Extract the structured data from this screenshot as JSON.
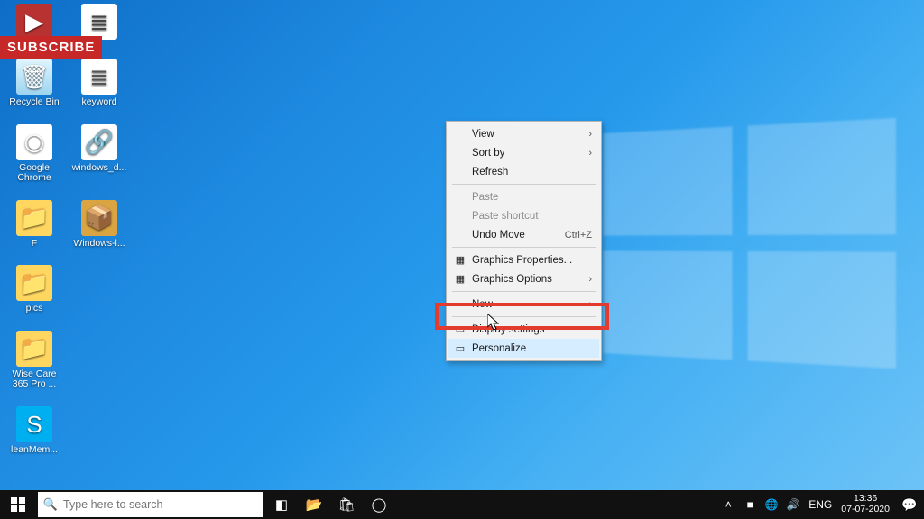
{
  "subscribe_label": "SUBSCRIBE",
  "desktop": {
    "icons": [
      [
        {
          "label": "",
          "glyph": "▶",
          "cls": "g-video",
          "name": "youtube-play-icon"
        },
        {
          "label": "",
          "glyph": "≣",
          "cls": "g-doc",
          "name": "document-icon"
        }
      ],
      [
        {
          "label": "Recycle Bin",
          "glyph": "🗑",
          "cls": "g-bin",
          "name": "recycle-bin-icon"
        },
        {
          "label": "keyword",
          "glyph": "≣",
          "cls": "g-txt",
          "name": "text-file-icon"
        }
      ],
      [
        {
          "label": "Google Chrome",
          "glyph": "◉",
          "cls": "g-chrome",
          "name": "chrome-icon"
        },
        {
          "label": "windows_d...",
          "glyph": "🔗",
          "cls": "g-link",
          "name": "shortcut-icon"
        }
      ],
      [
        {
          "label": "F",
          "glyph": "📁",
          "cls": "g-folder",
          "name": "folder-icon"
        },
        {
          "label": "Windows-l...",
          "glyph": "📦",
          "cls": "g-chest",
          "name": "file-chest-icon"
        }
      ],
      [
        {
          "label": "pics",
          "glyph": "📁",
          "cls": "g-folder",
          "name": "folder-icon"
        }
      ],
      [
        {
          "label": "Wise Care 365 Pro ...",
          "glyph": "📁",
          "cls": "g-folder",
          "name": "folder-icon"
        }
      ],
      [
        {
          "label": "leanMem...",
          "glyph": "S",
          "cls": "g-skype",
          "name": "skype-icon"
        }
      ]
    ]
  },
  "context_menu": {
    "items": [
      {
        "label": "View",
        "submenu": true,
        "kind": "item"
      },
      {
        "label": "Sort by",
        "submenu": true,
        "kind": "item"
      },
      {
        "label": "Refresh",
        "submenu": false,
        "kind": "item"
      },
      {
        "kind": "sep"
      },
      {
        "label": "Paste",
        "disabled": true,
        "kind": "item"
      },
      {
        "label": "Paste shortcut",
        "disabled": true,
        "kind": "item"
      },
      {
        "label": "Undo Move",
        "shortcut": "Ctrl+Z",
        "kind": "item"
      },
      {
        "kind": "sep"
      },
      {
        "label": "Graphics Properties...",
        "icon": "▦",
        "kind": "item"
      },
      {
        "label": "Graphics Options",
        "icon": "▦",
        "submenu": true,
        "kind": "item"
      },
      {
        "kind": "sep"
      },
      {
        "label": "New",
        "submenu": true,
        "kind": "item"
      },
      {
        "kind": "sep"
      },
      {
        "label": "Display settings",
        "icon": "▭",
        "kind": "item"
      },
      {
        "label": "Personalize",
        "icon": "▭",
        "hover": true,
        "kind": "item"
      }
    ]
  },
  "taskbar": {
    "search_placeholder": "Type here to search",
    "apps": [
      {
        "glyph": "◧",
        "name": "task-view-icon"
      },
      {
        "glyph": "📂",
        "name": "file-explorer-icon"
      },
      {
        "glyph": "🛍",
        "name": "microsoft-store-icon"
      },
      {
        "glyph": "◯",
        "name": "chrome-taskbar-icon"
      }
    ],
    "tray": [
      {
        "glyph": "˄",
        "name": "tray-overflow-icon"
      },
      {
        "glyph": "■",
        "name": "tray-app-icon"
      },
      {
        "glyph": "🌐",
        "name": "network-icon"
      },
      {
        "glyph": "🔊",
        "name": "volume-icon"
      }
    ],
    "language": "ENG",
    "time": "13:36",
    "date": "07-07-2020"
  }
}
